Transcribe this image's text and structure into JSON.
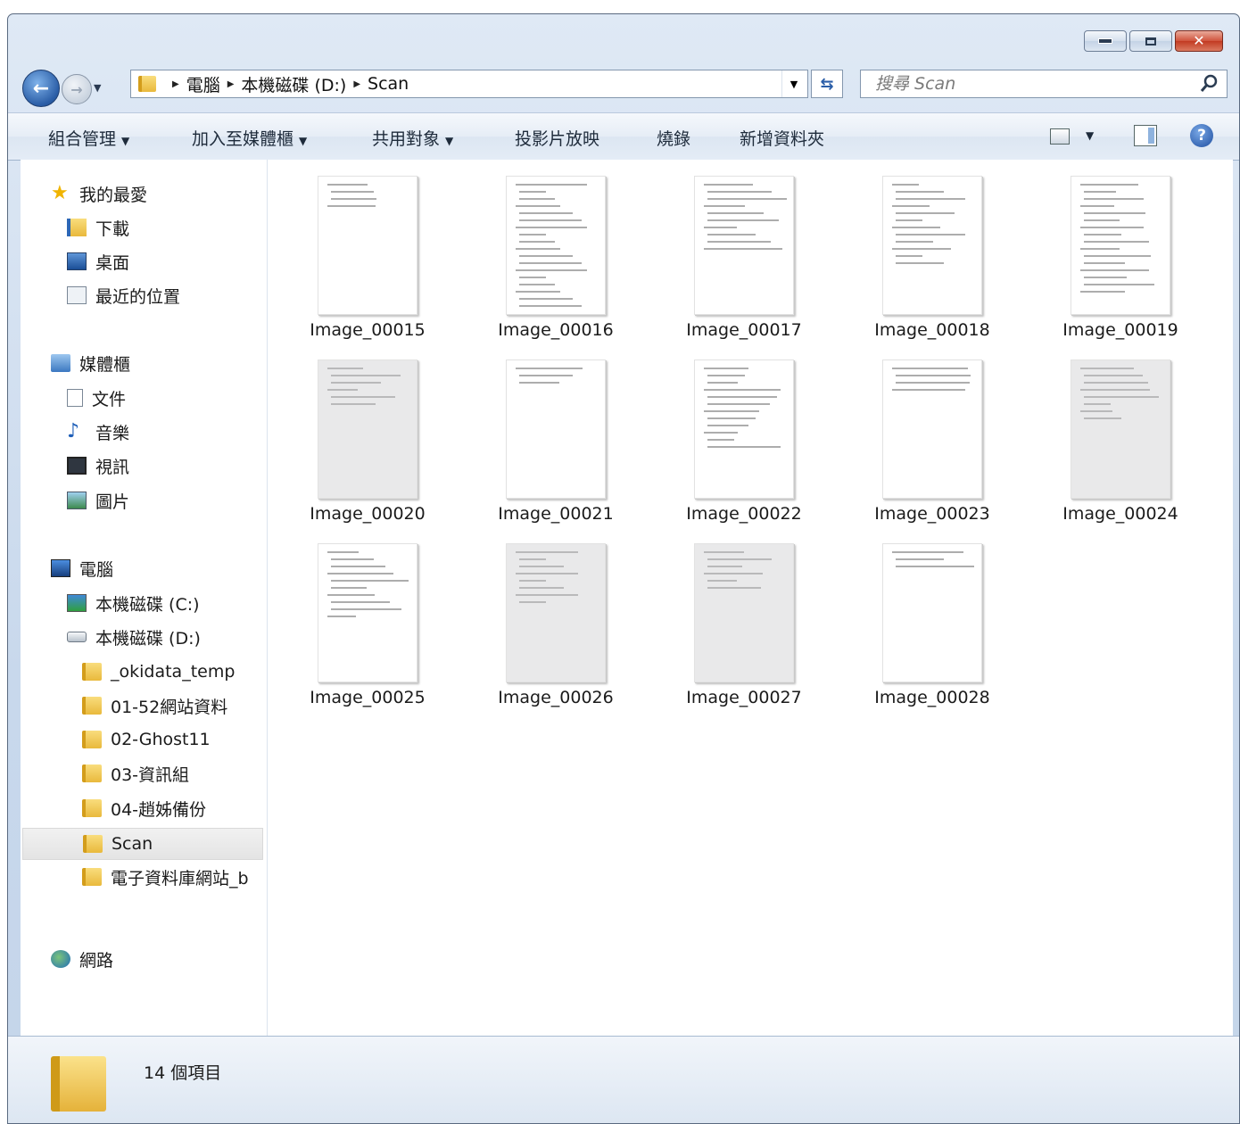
{
  "window": {
    "caption": {
      "minimize": "–",
      "maximize": "□",
      "close": "✕"
    }
  },
  "address": {
    "crumbs": [
      "電腦",
      "本機磁碟 (D:)",
      "Scan"
    ],
    "separator": "▶",
    "dropdown": "▼",
    "refresh": "⇆"
  },
  "search": {
    "placeholder": "搜尋 Scan"
  },
  "toolbar": {
    "organize": "組合管理",
    "add_to_library": "加入至媒體櫃",
    "share_with": "共用對象",
    "slideshow": "投影片放映",
    "burn": "燒錄",
    "new_folder": "新增資料夾",
    "dropdown_arrow": "▼",
    "help": "?"
  },
  "sidebar": {
    "favorites": {
      "label": "我的最愛",
      "items": [
        "下載",
        "桌面",
        "最近的位置"
      ]
    },
    "libraries": {
      "label": "媒體櫃",
      "items": [
        "文件",
        "音樂",
        "視訊",
        "圖片"
      ]
    },
    "computer": {
      "label": "電腦",
      "drives": [
        "本機磁碟 (C:)",
        "本機磁碟 (D:)"
      ],
      "folders": [
        "_okidata_temp",
        "01-52網站資料",
        "02-Ghost11",
        "03-資訊組",
        "04-趙姊備份",
        "Scan",
        "電子資料庫網站_b"
      ]
    },
    "network": {
      "label": "網路"
    },
    "selected": "Scan"
  },
  "files": [
    {
      "name": "Image_00015",
      "tone": "white"
    },
    {
      "name": "Image_00016",
      "tone": "white"
    },
    {
      "name": "Image_00017",
      "tone": "white"
    },
    {
      "name": "Image_00018",
      "tone": "white"
    },
    {
      "name": "Image_00019",
      "tone": "white"
    },
    {
      "name": "Image_00020",
      "tone": "gray"
    },
    {
      "name": "Image_00021",
      "tone": "white"
    },
    {
      "name": "Image_00022",
      "tone": "white"
    },
    {
      "name": "Image_00023",
      "tone": "white"
    },
    {
      "name": "Image_00024",
      "tone": "gray"
    },
    {
      "name": "Image_00025",
      "tone": "white"
    },
    {
      "name": "Image_00026",
      "tone": "gray"
    },
    {
      "name": "Image_00027",
      "tone": "gray"
    },
    {
      "name": "Image_00028",
      "tone": "white"
    }
  ],
  "status": {
    "item_count": "14 個項目"
  }
}
